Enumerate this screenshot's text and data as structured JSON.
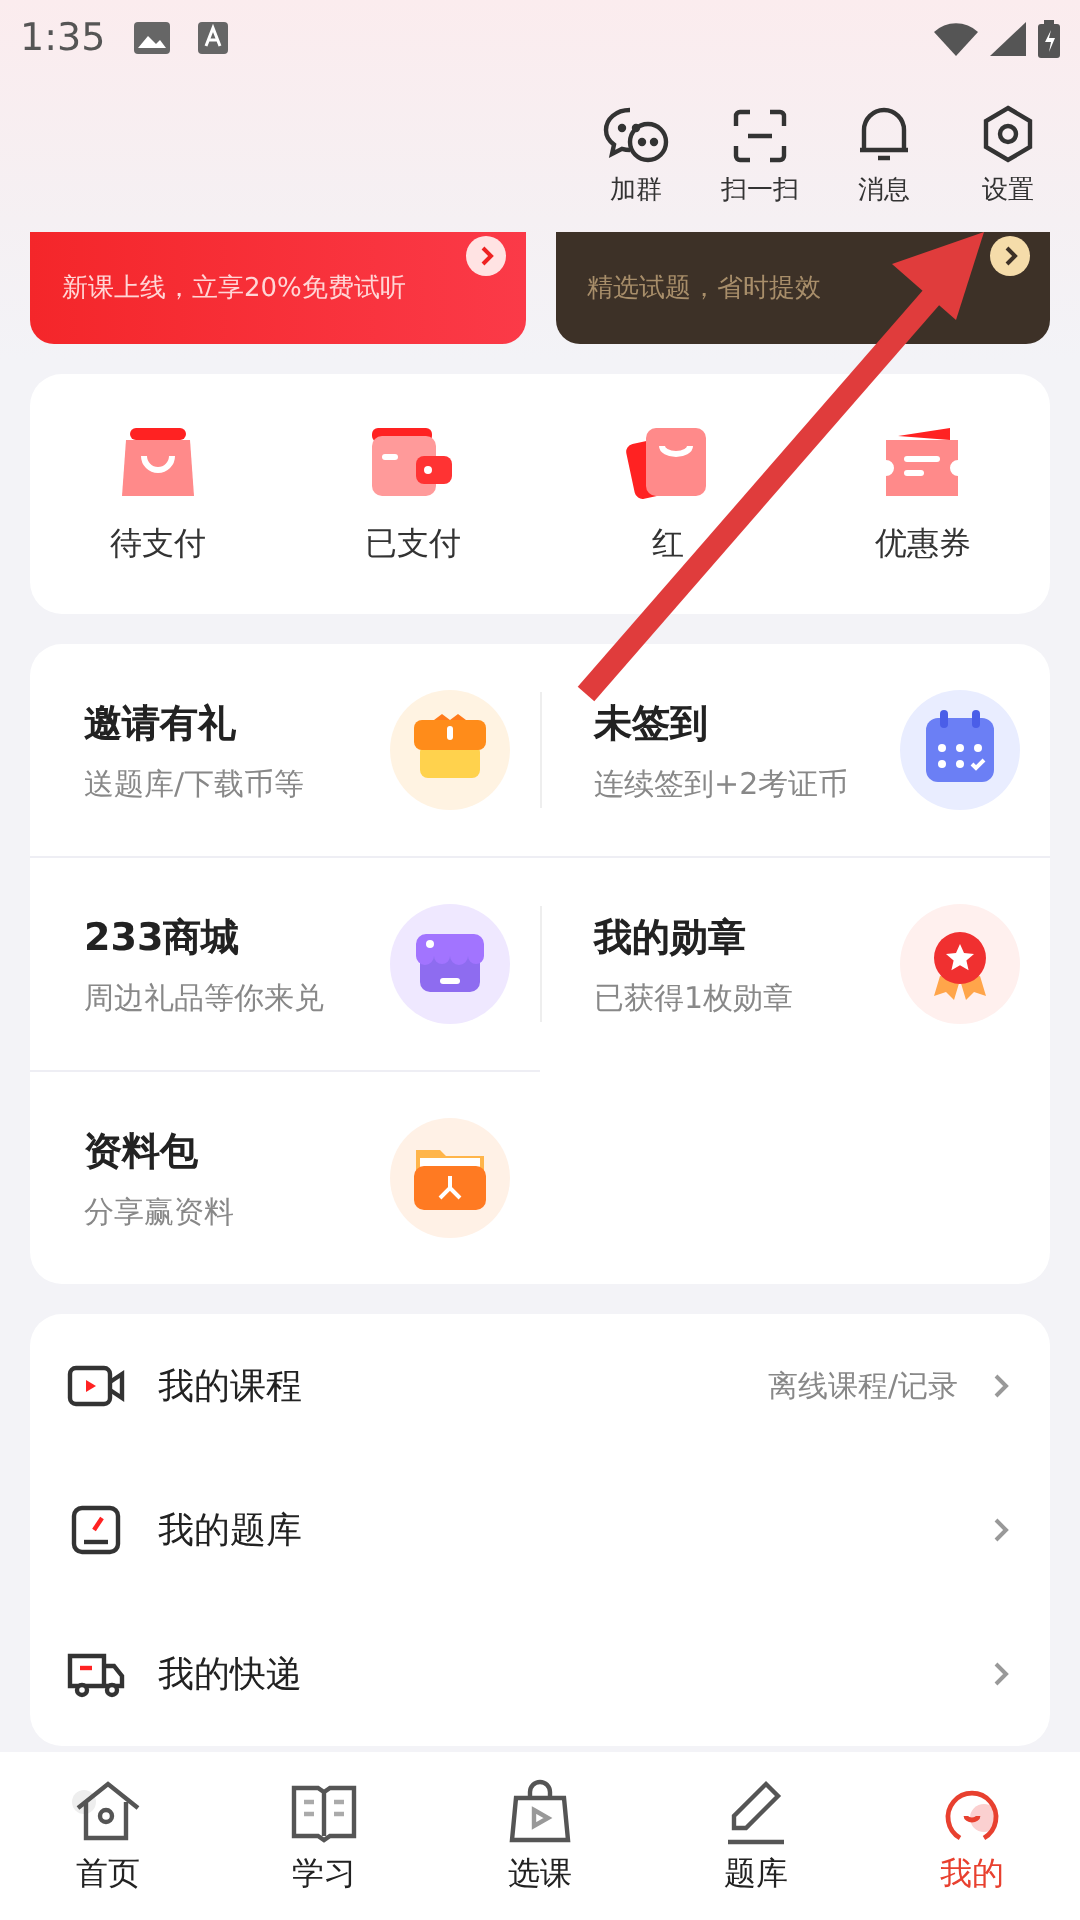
{
  "status_bar": {
    "time": "1:35"
  },
  "header_actions": [
    {
      "label": "加群"
    },
    {
      "label": "扫一扫"
    },
    {
      "label": "消息"
    },
    {
      "label": "设置"
    }
  ],
  "banners": [
    {
      "kind": "red",
      "subtitle": "新课上线，立享20%免费试听"
    },
    {
      "kind": "dark",
      "subtitle": "精选试题，省时提效"
    }
  ],
  "orders": [
    {
      "label": "待支付"
    },
    {
      "label": "已支付"
    },
    {
      "label": "红"
    },
    {
      "label": "优惠券"
    }
  ],
  "features": [
    {
      "title": "邀请有礼",
      "subtitle": "送题库/下载币等"
    },
    {
      "title": "未签到",
      "subtitle": "连续签到+2考证币"
    },
    {
      "title": "233商城",
      "subtitle": "周边礼品等你来兑"
    },
    {
      "title": "我的勋章",
      "subtitle": "已获得1枚勋章"
    },
    {
      "title": "资料包",
      "subtitle": "分享赢资料"
    }
  ],
  "menu": [
    {
      "label": "我的课程",
      "note": "离线课程/记录"
    },
    {
      "label": "我的题库"
    },
    {
      "label": "我的快递"
    }
  ],
  "tabs": [
    {
      "label": "首页",
      "selected": false
    },
    {
      "label": "学习",
      "selected": false
    },
    {
      "label": "选课",
      "selected": false
    },
    {
      "label": "题库",
      "selected": false
    },
    {
      "label": "我的",
      "selected": true
    }
  ]
}
